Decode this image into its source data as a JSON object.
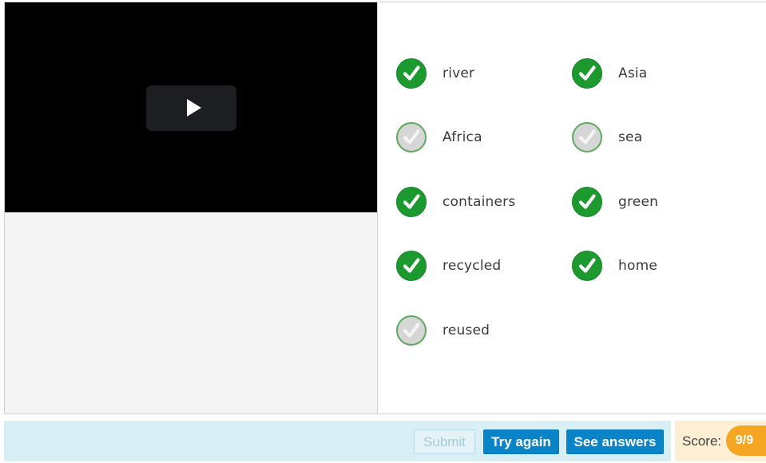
{
  "options": [
    {
      "label": "river",
      "checked": true
    },
    {
      "label": "Asia",
      "checked": true
    },
    {
      "label": "Africa",
      "checked": false
    },
    {
      "label": "sea",
      "checked": false
    },
    {
      "label": "containers",
      "checked": true
    },
    {
      "label": "green",
      "checked": true
    },
    {
      "label": "recycled",
      "checked": true
    },
    {
      "label": "home",
      "checked": true
    },
    {
      "label": "reused",
      "checked": false
    }
  ],
  "buttons": {
    "submit": "Submit",
    "try_again": "Try again",
    "see_answers": "See answers"
  },
  "score": {
    "label": "Score:",
    "value": "9/9"
  },
  "colors": {
    "checked": "#1d9a2f",
    "unchecked": "#d6d6d6",
    "primary_button": "#0a84c9",
    "footer": "#d9eff6",
    "score_badge": "#f5a623"
  }
}
